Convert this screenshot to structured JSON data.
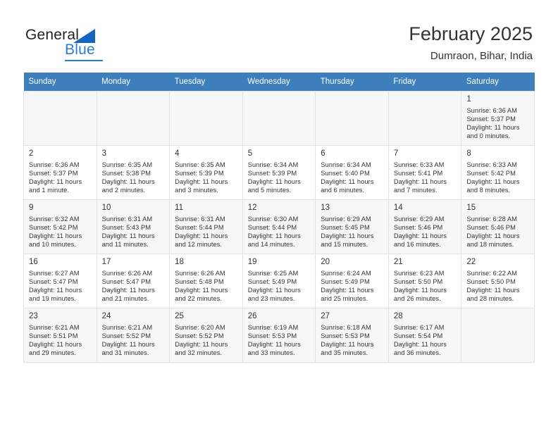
{
  "brand": {
    "name_part1": "General",
    "name_part2": "Blue"
  },
  "header": {
    "title": "February 2025",
    "location": "Dumraon, Bihar, India"
  },
  "calendar": {
    "weekday_headers": [
      "Sunday",
      "Monday",
      "Tuesday",
      "Wednesday",
      "Thursday",
      "Friday",
      "Saturday"
    ],
    "accent_color": "#3d7ebd",
    "shaded_row_color": "#f7f7f7",
    "labels": {
      "sunrise": "Sunrise:",
      "sunset": "Sunset:",
      "daylight": "Daylight:"
    },
    "weeks": [
      [
        {
          "day": "",
          "lines": []
        },
        {
          "day": "",
          "lines": []
        },
        {
          "day": "",
          "lines": []
        },
        {
          "day": "",
          "lines": []
        },
        {
          "day": "",
          "lines": []
        },
        {
          "day": "",
          "lines": []
        },
        {
          "day": "1",
          "lines": [
            "Sunrise: 6:36 AM",
            "Sunset: 5:37 PM",
            "Daylight: 11 hours",
            "and 0 minutes."
          ]
        }
      ],
      [
        {
          "day": "2",
          "lines": [
            "Sunrise: 6:36 AM",
            "Sunset: 5:37 PM",
            "Daylight: 11 hours",
            "and 1 minute."
          ]
        },
        {
          "day": "3",
          "lines": [
            "Sunrise: 6:35 AM",
            "Sunset: 5:38 PM",
            "Daylight: 11 hours",
            "and 2 minutes."
          ]
        },
        {
          "day": "4",
          "lines": [
            "Sunrise: 6:35 AM",
            "Sunset: 5:39 PM",
            "Daylight: 11 hours",
            "and 3 minutes."
          ]
        },
        {
          "day": "5",
          "lines": [
            "Sunrise: 6:34 AM",
            "Sunset: 5:39 PM",
            "Daylight: 11 hours",
            "and 5 minutes."
          ]
        },
        {
          "day": "6",
          "lines": [
            "Sunrise: 6:34 AM",
            "Sunset: 5:40 PM",
            "Daylight: 11 hours",
            "and 6 minutes."
          ]
        },
        {
          "day": "7",
          "lines": [
            "Sunrise: 6:33 AM",
            "Sunset: 5:41 PM",
            "Daylight: 11 hours",
            "and 7 minutes."
          ]
        },
        {
          "day": "8",
          "lines": [
            "Sunrise: 6:33 AM",
            "Sunset: 5:42 PM",
            "Daylight: 11 hours",
            "and 8 minutes."
          ]
        }
      ],
      [
        {
          "day": "9",
          "lines": [
            "Sunrise: 6:32 AM",
            "Sunset: 5:42 PM",
            "Daylight: 11 hours",
            "and 10 minutes."
          ]
        },
        {
          "day": "10",
          "lines": [
            "Sunrise: 6:31 AM",
            "Sunset: 5:43 PM",
            "Daylight: 11 hours",
            "and 11 minutes."
          ]
        },
        {
          "day": "11",
          "lines": [
            "Sunrise: 6:31 AM",
            "Sunset: 5:44 PM",
            "Daylight: 11 hours",
            "and 12 minutes."
          ]
        },
        {
          "day": "12",
          "lines": [
            "Sunrise: 6:30 AM",
            "Sunset: 5:44 PM",
            "Daylight: 11 hours",
            "and 14 minutes."
          ]
        },
        {
          "day": "13",
          "lines": [
            "Sunrise: 6:29 AM",
            "Sunset: 5:45 PM",
            "Daylight: 11 hours",
            "and 15 minutes."
          ]
        },
        {
          "day": "14",
          "lines": [
            "Sunrise: 6:29 AM",
            "Sunset: 5:46 PM",
            "Daylight: 11 hours",
            "and 16 minutes."
          ]
        },
        {
          "day": "15",
          "lines": [
            "Sunrise: 6:28 AM",
            "Sunset: 5:46 PM",
            "Daylight: 11 hours",
            "and 18 minutes."
          ]
        }
      ],
      [
        {
          "day": "16",
          "lines": [
            "Sunrise: 6:27 AM",
            "Sunset: 5:47 PM",
            "Daylight: 11 hours",
            "and 19 minutes."
          ]
        },
        {
          "day": "17",
          "lines": [
            "Sunrise: 6:26 AM",
            "Sunset: 5:47 PM",
            "Daylight: 11 hours",
            "and 21 minutes."
          ]
        },
        {
          "day": "18",
          "lines": [
            "Sunrise: 6:26 AM",
            "Sunset: 5:48 PM",
            "Daylight: 11 hours",
            "and 22 minutes."
          ]
        },
        {
          "day": "19",
          "lines": [
            "Sunrise: 6:25 AM",
            "Sunset: 5:49 PM",
            "Daylight: 11 hours",
            "and 23 minutes."
          ]
        },
        {
          "day": "20",
          "lines": [
            "Sunrise: 6:24 AM",
            "Sunset: 5:49 PM",
            "Daylight: 11 hours",
            "and 25 minutes."
          ]
        },
        {
          "day": "21",
          "lines": [
            "Sunrise: 6:23 AM",
            "Sunset: 5:50 PM",
            "Daylight: 11 hours",
            "and 26 minutes."
          ]
        },
        {
          "day": "22",
          "lines": [
            "Sunrise: 6:22 AM",
            "Sunset: 5:50 PM",
            "Daylight: 11 hours",
            "and 28 minutes."
          ]
        }
      ],
      [
        {
          "day": "23",
          "lines": [
            "Sunrise: 6:21 AM",
            "Sunset: 5:51 PM",
            "Daylight: 11 hours",
            "and 29 minutes."
          ]
        },
        {
          "day": "24",
          "lines": [
            "Sunrise: 6:21 AM",
            "Sunset: 5:52 PM",
            "Daylight: 11 hours",
            "and 31 minutes."
          ]
        },
        {
          "day": "25",
          "lines": [
            "Sunrise: 6:20 AM",
            "Sunset: 5:52 PM",
            "Daylight: 11 hours",
            "and 32 minutes."
          ]
        },
        {
          "day": "26",
          "lines": [
            "Sunrise: 6:19 AM",
            "Sunset: 5:53 PM",
            "Daylight: 11 hours",
            "and 33 minutes."
          ]
        },
        {
          "day": "27",
          "lines": [
            "Sunrise: 6:18 AM",
            "Sunset: 5:53 PM",
            "Daylight: 11 hours",
            "and 35 minutes."
          ]
        },
        {
          "day": "28",
          "lines": [
            "Sunrise: 6:17 AM",
            "Sunset: 5:54 PM",
            "Daylight: 11 hours",
            "and 36 minutes."
          ]
        },
        {
          "day": "",
          "lines": []
        }
      ]
    ]
  }
}
